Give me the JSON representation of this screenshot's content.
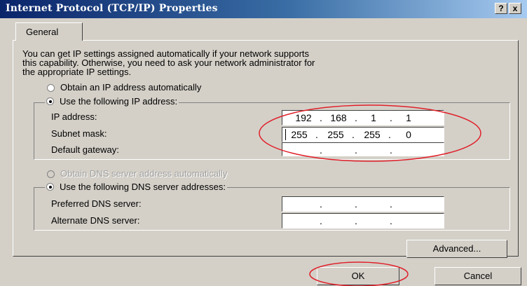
{
  "window": {
    "title": "Internet Protocol (TCP/IP) Properties",
    "help_label": "?",
    "close_label": "x"
  },
  "tabs": [
    {
      "label": "General"
    }
  ],
  "description": {
    "line1": "You can get IP settings assigned automatically if your network supports",
    "line2": "this capability. Otherwise, you need to ask your network administrator for",
    "line3": "the appropriate IP settings."
  },
  "ip_section": {
    "auto_label": "Obtain an IP address automatically",
    "auto_selected": false,
    "manual_label": "Use the following IP address:",
    "manual_selected": true,
    "fields": [
      {
        "label": "IP address:",
        "octets": [
          "192",
          "168",
          "1",
          "1"
        ]
      },
      {
        "label": "Subnet mask:",
        "octets": [
          "255",
          "255",
          "255",
          "0"
        ]
      },
      {
        "label": "Default gateway:",
        "octets": [
          "",
          "",
          "",
          ""
        ]
      }
    ]
  },
  "dns_section": {
    "auto_label": "Obtain DNS server address automatically",
    "auto_selected": false,
    "auto_disabled": true,
    "manual_label": "Use the following DNS server addresses:",
    "manual_selected": true,
    "fields": [
      {
        "label": "Preferred DNS server:",
        "octets": [
          "",
          "",
          "",
          ""
        ]
      },
      {
        "label": "Alternate DNS server:",
        "octets": [
          "",
          "",
          "",
          ""
        ]
      }
    ]
  },
  "buttons": {
    "advanced": "Advanced...",
    "ok": "OK",
    "cancel": "Cancel"
  },
  "colors": {
    "face": "#d4d0c8",
    "title_start": "#0a246a",
    "annotation_red": "#e0202a"
  }
}
